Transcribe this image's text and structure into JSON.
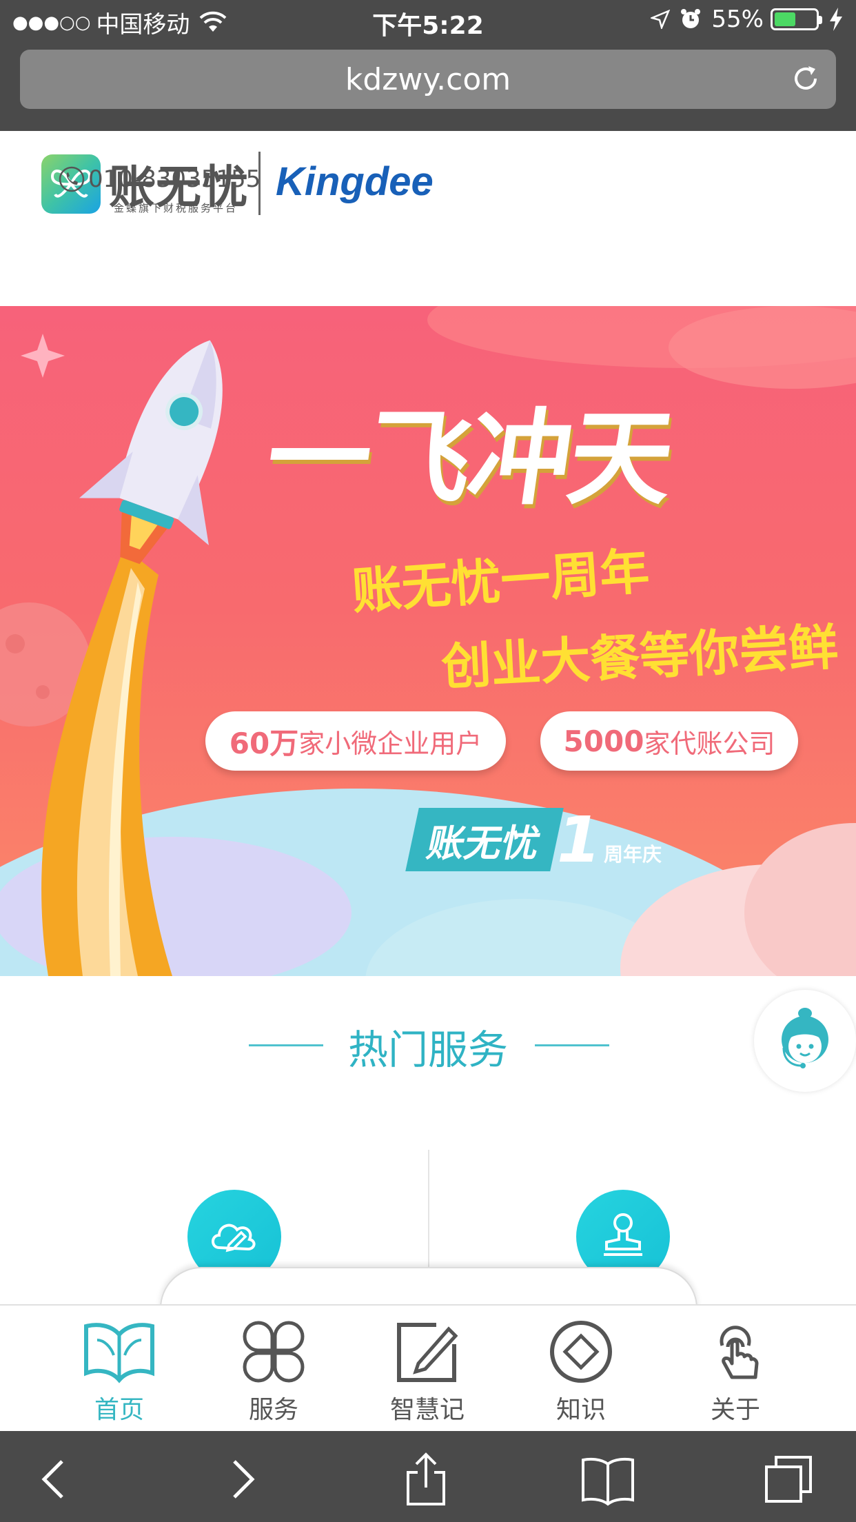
{
  "status_bar": {
    "signal_dots": "●●●○○",
    "carrier": "中国移动",
    "time": "下午5:22",
    "battery_percent": "55%",
    "battery_level": 0.55,
    "battery_color": "#4cd964"
  },
  "browser": {
    "url": "kdzwy.com",
    "icons": [
      "wifi-icon",
      "location-arrow-icon",
      "alarm-icon",
      "charging-bolt-icon",
      "reload-icon",
      "back-icon",
      "forward-icon",
      "share-icon",
      "bookmarks-icon",
      "tabs-icon"
    ]
  },
  "header": {
    "logo_title": "账无忧",
    "logo_subtitle": "金蝶旗下财税服务平台",
    "brand": "Kingdee",
    "phone": "010-83035155"
  },
  "banner": {
    "headline": "一飞冲天",
    "line1": "账无忧一周年",
    "line2": "创业大餐等你尝鲜",
    "pill1_number": "60万",
    "pill1_text": "家小微企业用户",
    "pill2_number": "5000",
    "pill2_text": "家代账公司",
    "badge_brand": "账无忧",
    "badge_number": "1",
    "badge_label": "周年庆"
  },
  "hot_services": {
    "title": "热门服务",
    "items": [
      {
        "icon": "cloud-edit-icon"
      },
      {
        "icon": "stamp-icon"
      }
    ]
  },
  "tabbar": {
    "tabs": [
      {
        "label": "首页",
        "icon": "book-icon",
        "active": true
      },
      {
        "label": "服务",
        "icon": "four-circles-icon",
        "active": false
      },
      {
        "label": "智慧记",
        "icon": "edit-note-icon",
        "active": false
      },
      {
        "label": "知识",
        "icon": "diamond-icon",
        "active": false
      },
      {
        "label": "关于",
        "icon": "touch-hand-icon",
        "active": false
      }
    ]
  },
  "colors": {
    "accent": "#35b6c2",
    "browser_chrome": "#4a4a4a",
    "banner_red": "#f7627a",
    "banner_yellow": "#ffe033",
    "brand_blue": "#1860b8"
  }
}
